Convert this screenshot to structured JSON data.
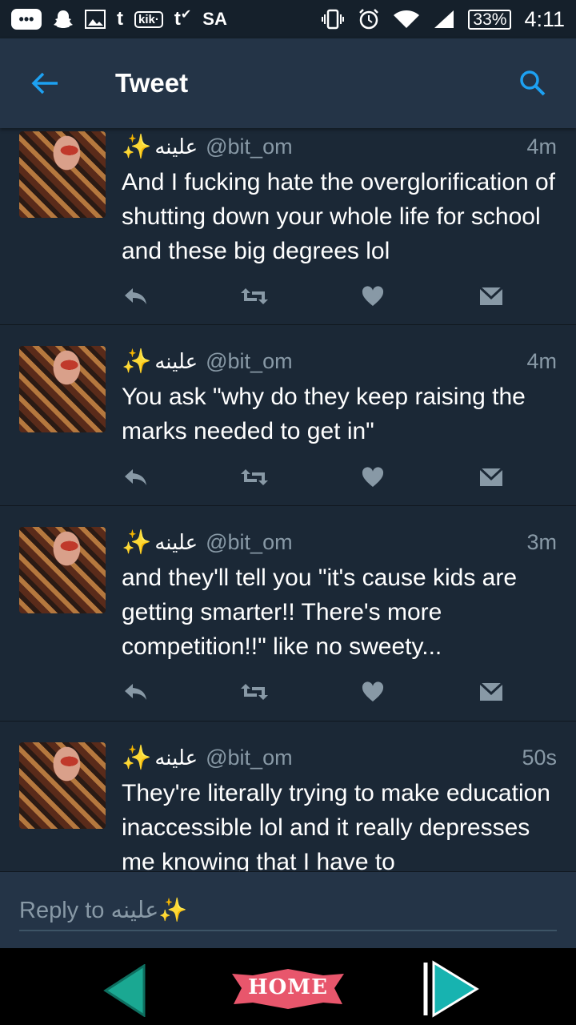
{
  "status_bar": {
    "carrier": "SA",
    "battery": "33%",
    "time": "4:11",
    "kik_label": "kik·",
    "tumblr_label": "t",
    "tumblr2_label": "t"
  },
  "app_bar": {
    "title": "Tweet"
  },
  "tweets": [
    {
      "name": "علينه",
      "handle": "@bit_om",
      "time": "4m",
      "text": "And I fucking hate the overglorification of shutting down your whole life for school and these big degrees lol"
    },
    {
      "name": "علينه",
      "handle": "@bit_om",
      "time": "4m",
      "text": "You ask \"why do they keep raising the marks needed to get in\""
    },
    {
      "name": "علينه",
      "handle": "@bit_om",
      "time": "3m",
      "text": "and they'll tell you \"it's cause kids are getting smarter!! There's more competition!!\" like no sweety..."
    },
    {
      "name": "علينه",
      "handle": "@bit_om",
      "time": "50s",
      "text": "They're literally trying to make education inaccessible lol and it really depresses me knowing that I have to"
    }
  ],
  "reply": {
    "placeholder": "Reply to علينه✨"
  },
  "navbar": {
    "home_label": "HOME"
  },
  "colors": {
    "accent": "#1da1f2",
    "background": "#1b2836",
    "appbar": "#243447",
    "secondary_text": "#8899a6"
  }
}
